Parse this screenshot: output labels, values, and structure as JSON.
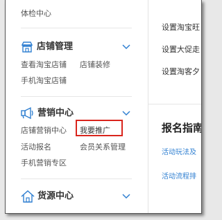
{
  "sidebar": {
    "top_item": "体检中心",
    "sections": [
      {
        "icon": "store-icon",
        "title": "店铺管理",
        "items": [
          "查看淘宝店铺",
          "店铺装修",
          "手机淘宝店铺"
        ]
      },
      {
        "icon": "megaphone-icon",
        "title": "营销中心",
        "items": [
          "店铺营销中心",
          "我要推广",
          "活动报名",
          "会员关系管理",
          "手机营销专区"
        ]
      },
      {
        "icon": "home-icon",
        "title": "货源中心"
      }
    ],
    "highlighted_item": "我要推广"
  },
  "right_panel": {
    "links": [
      "设置淘宝旺",
      "设置大促走",
      "设置淘客夕"
    ],
    "report_title": "报名指南",
    "guide_links": [
      "活动玩法及",
      "活动流程排"
    ]
  },
  "colors": {
    "accent": "#2f7fd1",
    "highlight": "#d9241c"
  }
}
